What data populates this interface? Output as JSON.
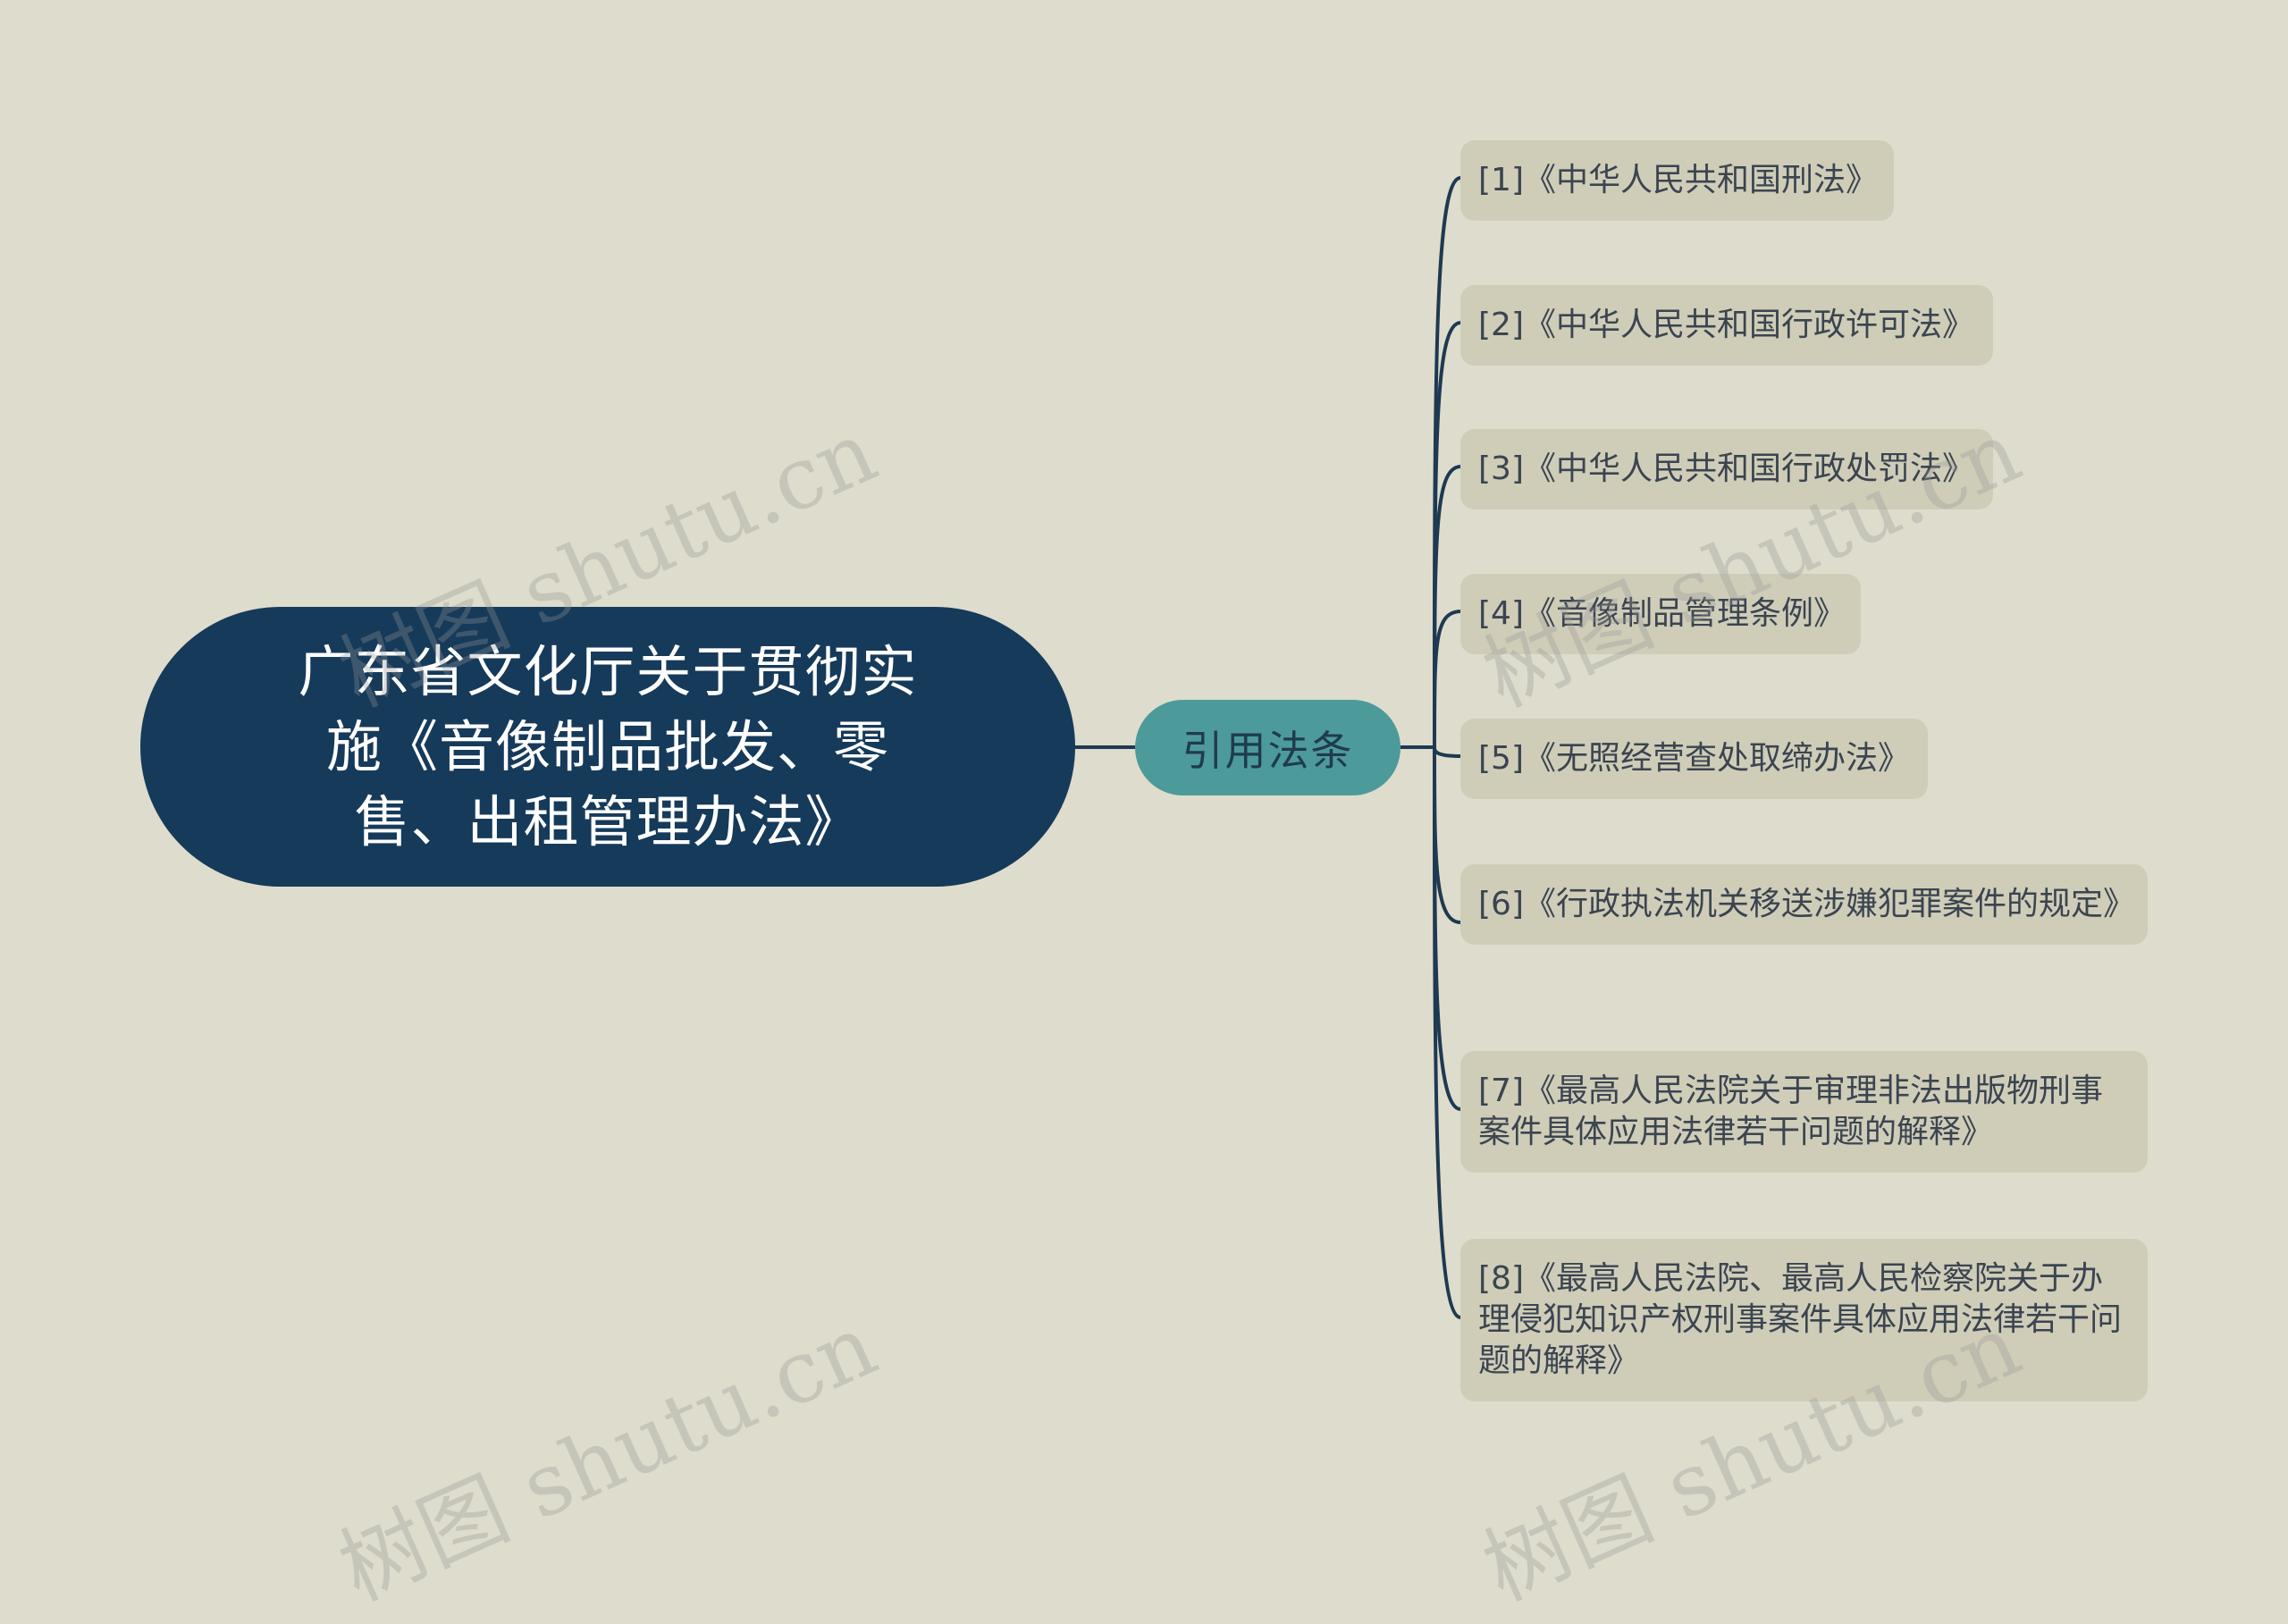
{
  "root": {
    "title": "广东省文化厅关于贯彻实施《音像制品批发、零售、出租管理办法》"
  },
  "branch": {
    "label": "引用法条"
  },
  "leaves": [
    "[1]《中华人民共和国刑法》",
    "[2]《中华人民共和国行政许可法》",
    "[3]《中华人民共和国行政处罚法》",
    "[4]《音像制品管理条例》",
    "[5]《无照经营查处取缔办法》",
    "[6]《行政执法机关移送涉嫌犯罪案件的规定》",
    "[7]《最高人民法院关于审理非法出版物刑事案件具体应用法律若干问题的解释》",
    "[8]《最高人民法院、最高人民检察院关于办理侵犯知识产权刑事案件具体应用法律若干问题的解释》"
  ],
  "watermark": "树图 shutu.cn",
  "colors": {
    "background": "#dedccc",
    "root": "#163a5a",
    "branch": "#4d9a9a",
    "leaf": "#cfcdb8",
    "connector": "#1e3a52"
  }
}
